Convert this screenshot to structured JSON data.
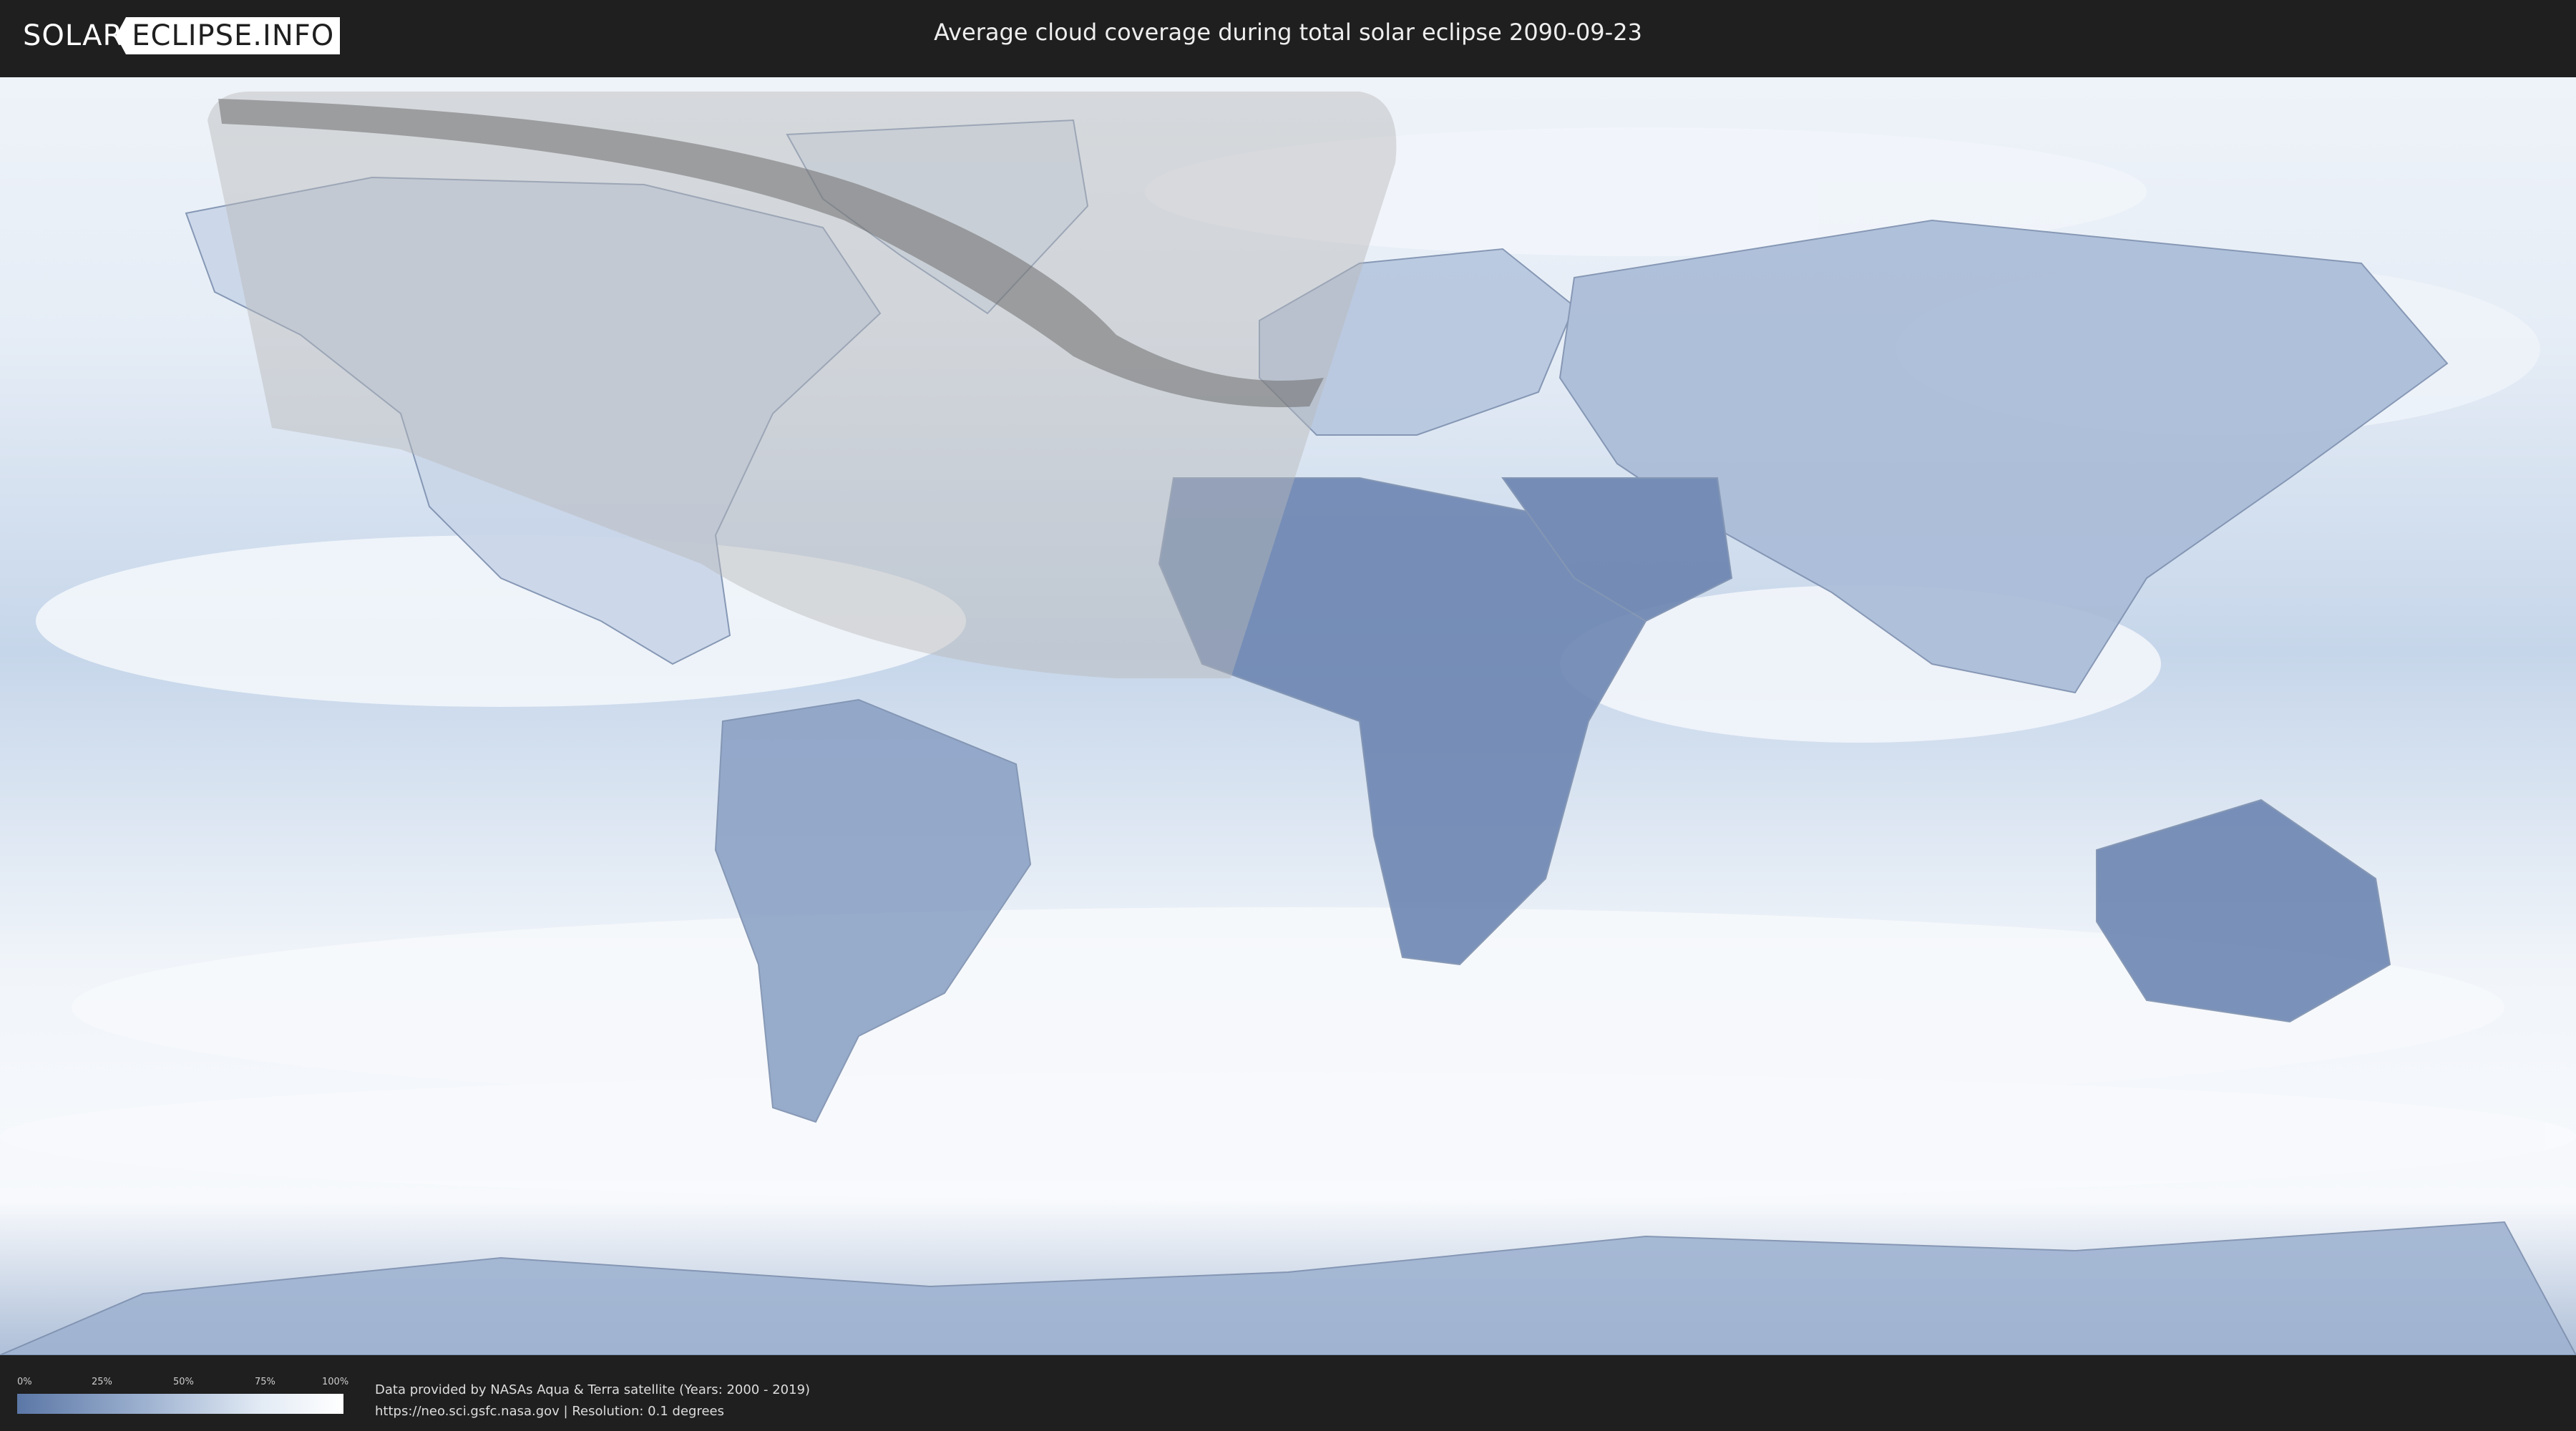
{
  "header": {
    "logo_part1": "SOLAR",
    "logo_part2": "ECLIPSE.INFO",
    "title": "Average cloud coverage during total solar eclipse 2090-09-23"
  },
  "map": {
    "ocean_color": "#c2d3e8",
    "land_color": "#6f88b4",
    "cloud_color": "#f4f7fb",
    "shadow_color": "#b9b9b9",
    "path_color": "#6e6e6e"
  },
  "legend": {
    "ticks": [
      "0%",
      "25%",
      "50%",
      "75%",
      "100%"
    ],
    "gradient_start": "#5b77a6",
    "gradient_end": "#ffffff"
  },
  "credits": {
    "line1": "Data provided by NASAs Aqua & Terra satellite (Years: 2000 - 2019)",
    "line2": "https://neo.sci.gsfc.nasa.gov | Resolution: 0.1 degrees"
  }
}
